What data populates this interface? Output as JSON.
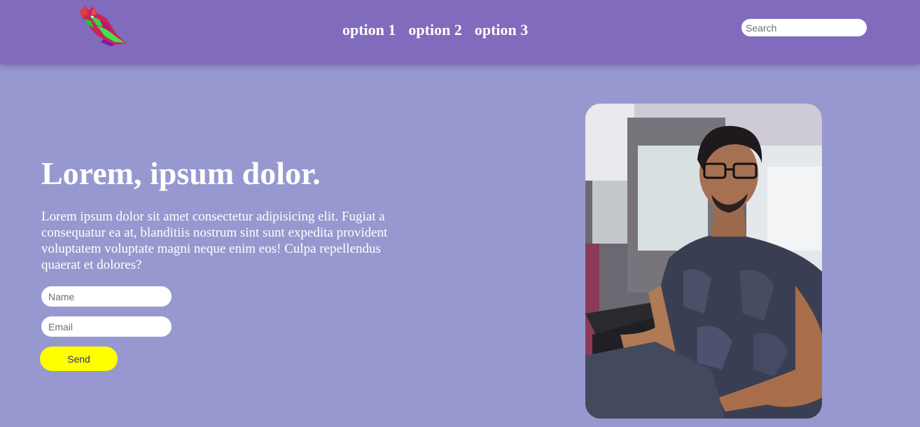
{
  "header": {
    "logo_icon": "wolf-head-logo-icon",
    "nav": [
      {
        "label": "option 1"
      },
      {
        "label": "option 2"
      },
      {
        "label": "option 3"
      }
    ],
    "search": {
      "placeholder": "Search",
      "value": ""
    }
  },
  "hero": {
    "title": "Lorem, ipsum dolor.",
    "text": "Lorem ipsum dolor sit amet consectetur adipisicing elit. Fugiat a consequatur ea at, blanditiis nostrum sint sunt expedita provident voluptatem voluptate magni neque enim eos! Culpa repellendus quaerat et dolores?",
    "form": {
      "name_placeholder": "Name",
      "email_placeholder": "Email",
      "send_label": "Send"
    },
    "photo_icon": "person-portrait-photo"
  },
  "colors": {
    "navbar": "#816bbc",
    "background": "#9898d0",
    "button": "#ffff00",
    "button_text": "#2d2d8a",
    "text": "#ffffff"
  }
}
